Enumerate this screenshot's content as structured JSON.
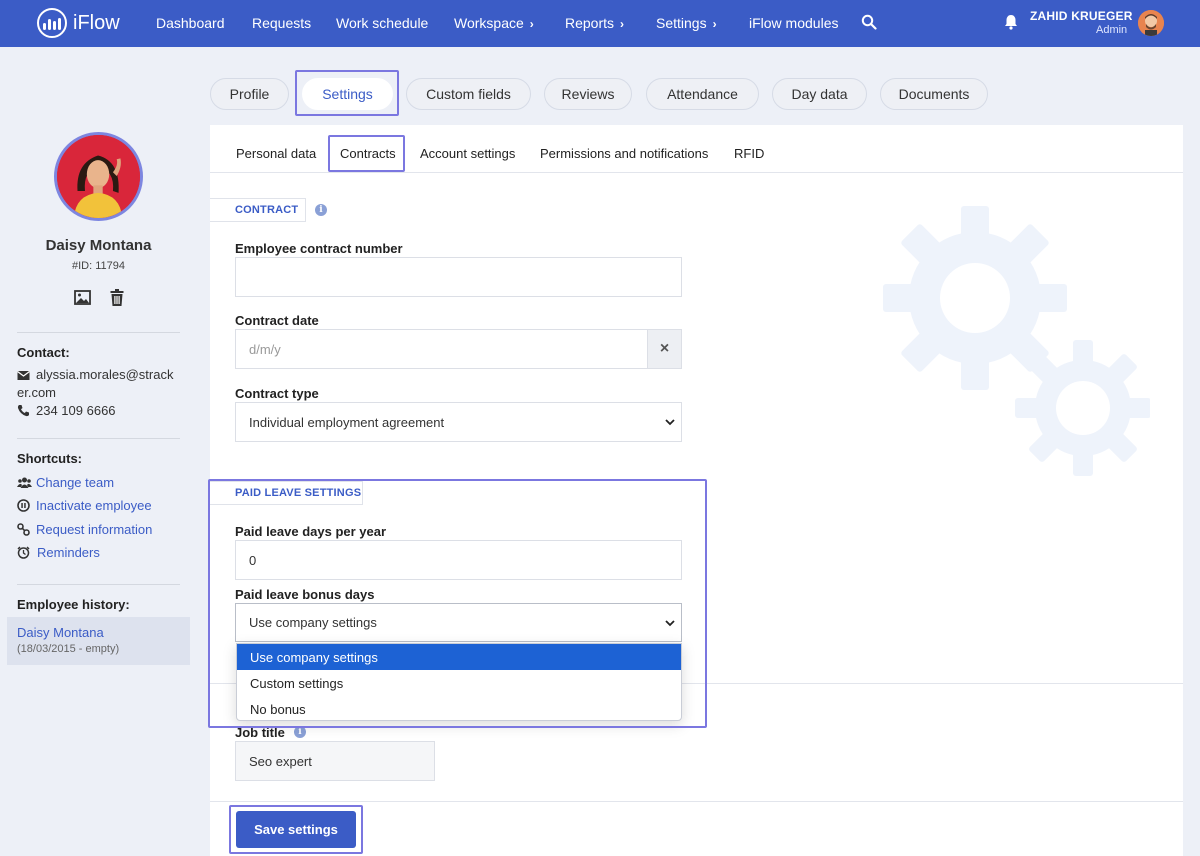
{
  "app": {
    "name": "iFlow"
  },
  "nav": {
    "items": [
      "Dashboard",
      "Requests",
      "Work schedule",
      "Workspace",
      "Reports",
      "Settings",
      "iFlow modules"
    ],
    "user_name": "ZAHID KRUEGER",
    "user_role": "Admin"
  },
  "tabs": [
    "Profile",
    "Settings",
    "Custom fields",
    "Reviews",
    "Attendance",
    "Day data",
    "Documents"
  ],
  "active_tab": "Settings",
  "subtabs": [
    "Personal data",
    "Contracts",
    "Account settings",
    "Permissions and notifications",
    "RFID"
  ],
  "active_subtab": "Contracts",
  "employee": {
    "name": "Daisy Montana",
    "id": "#ID: 11794",
    "contact_heading": "Contact:",
    "email_line1": "alyssia.morales@strack",
    "email_line2": "er.com",
    "phone": "234 109 6666",
    "shortcuts_heading": "Shortcuts:",
    "shortcuts": [
      "Change team",
      "Inactivate employee",
      "Request information",
      "Reminders"
    ],
    "history_heading": "Employee history:",
    "history_name": "Daisy Montana",
    "history_date": "(18/03/2015 - empty)"
  },
  "contract": {
    "section_title": "CONTRACT",
    "contract_number_label": "Employee contract number",
    "contract_number_value": "",
    "contract_date_label": "Contract date",
    "contract_date_placeholder": "d/m/y",
    "contract_type_label": "Contract type",
    "contract_type_value": "Individual employment agreement"
  },
  "paid_leave": {
    "section_title": "PAID LEAVE SETTINGS",
    "days_label": "Paid leave days per year",
    "days_value": "0",
    "bonus_label": "Paid leave bonus days",
    "bonus_value": "Use company settings",
    "bonus_options": [
      "Use company settings",
      "Custom settings",
      "No bonus"
    ]
  },
  "job": {
    "label": "Job title",
    "value": "Seo expert"
  },
  "save_label": "Save settings",
  "colors": {
    "primary": "#3b5cc6",
    "highlight": "#7b77e0",
    "dropdown_selected": "#1d62d4"
  }
}
